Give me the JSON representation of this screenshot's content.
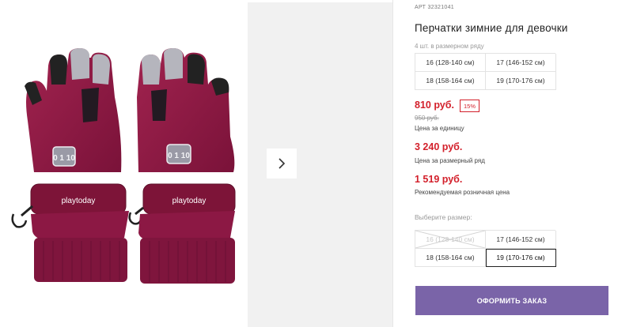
{
  "product": {
    "article_label": "АРТ",
    "article": "32321041",
    "title": "Перчатки зимние для девочки",
    "pack_note": "4 шт. в размерном ряду",
    "sizes_in_pack": [
      "16 (128-140 см)",
      "17 (146-152 см)",
      "18 (158-164 см)",
      "19 (170-176 см)"
    ]
  },
  "pricing": {
    "unit_price": "810 руб.",
    "discount": "15%",
    "old_price": "950 руб.",
    "unit_label": "Цена за единицу",
    "row_price": "3 240 руб.",
    "row_label": "Цена за размерный ряд",
    "rrp_price": "1 519 руб.",
    "rrp_label": "Рекомендуемая розничная цена"
  },
  "size_picker": {
    "label": "Выберите размер:",
    "options": [
      {
        "label": "16 (128-140 см)",
        "state": "unavailable"
      },
      {
        "label": "17 (146-152 см)",
        "state": "available"
      },
      {
        "label": "18 (158-164 см)",
        "state": "available"
      },
      {
        "label": "19 (170-176 см)",
        "state": "selected"
      }
    ]
  },
  "actions": {
    "order_label": "ОФОРМИТЬ ЗАКАЗ"
  },
  "gallery": {
    "brand_text": "playtoday",
    "patch_text": "0 1 10",
    "next_icon": "chevron-right-icon"
  },
  "colors": {
    "price_red": "#d3202b",
    "button_purple": "#7a64a8",
    "glove_berry": "#8e1a45"
  }
}
